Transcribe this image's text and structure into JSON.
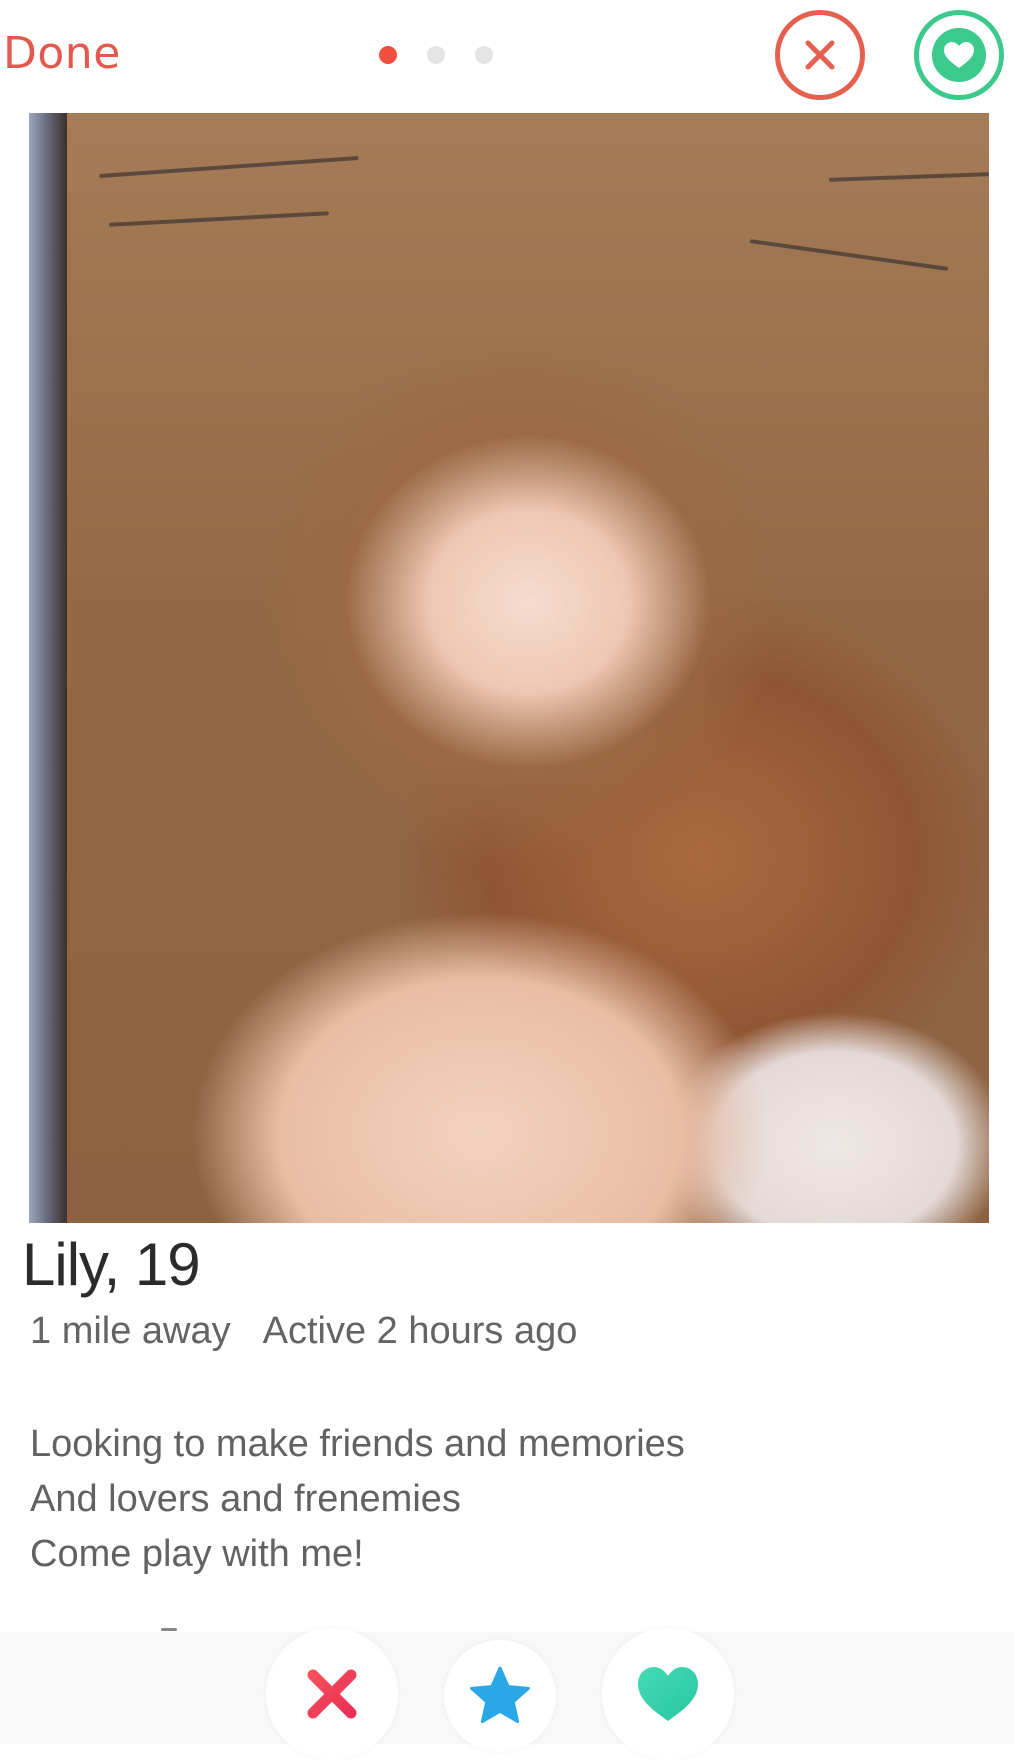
{
  "header": {
    "done_label": "Done",
    "page_indicator": {
      "total": 3,
      "active": 1
    },
    "dislike_icon": "close-circle-icon",
    "like_icon": "heart-circle-icon"
  },
  "profile": {
    "name_age": "Lily, 19",
    "distance": "1 mile away",
    "activity": "Active 2 hours ago",
    "bio_lines": [
      "Looking to make friends and memories",
      "And lovers and frenemies",
      "Come play with me!"
    ]
  },
  "actions": {
    "nope_icon": "x-icon",
    "super_like_icon": "star-icon",
    "like_icon": "heart-icon"
  },
  "colors": {
    "accent_red": "#e5584e",
    "dot_active": "#f04f3e",
    "like_green": "#3cc98c",
    "super_like_blue": "#2aa7e7",
    "heart_teal": "#39d3b0",
    "nope_red": "#f0415b"
  }
}
